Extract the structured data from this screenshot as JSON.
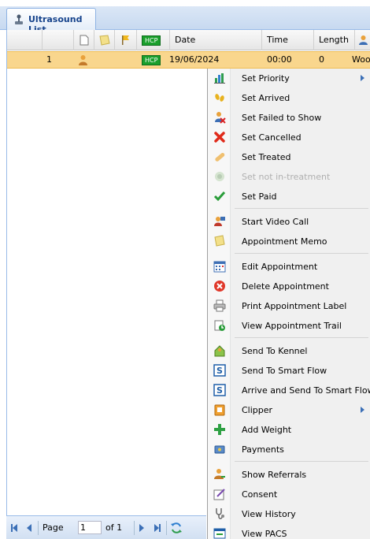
{
  "tab": {
    "label": "Ultrasound List"
  },
  "grid": {
    "headers": {
      "hcp_badge": "HCP",
      "date": "Date",
      "time": "Time",
      "length": "Length"
    },
    "row": {
      "number": "1",
      "hcp_badge": "HCP",
      "date": "19/06/2024",
      "time": "00:00",
      "length": "0",
      "name_partial": "Wooc"
    }
  },
  "pager": {
    "page_label": "Page",
    "page_value": "1",
    "of_label": "of 1"
  },
  "menu": {
    "items": [
      {
        "label": "Set Priority",
        "icon": "chart-icon"
      },
      {
        "label": "Set Arrived",
        "icon": "footprints-icon"
      },
      {
        "label": "Set Failed to Show",
        "icon": "person-cross-icon"
      },
      {
        "label": "Set Cancelled",
        "icon": "red-x-icon"
      },
      {
        "label": "Set Treated",
        "icon": "bandage-icon"
      },
      {
        "label": "Set not in-treatment",
        "icon": "stethoscope-icon"
      },
      {
        "label": "Set Paid",
        "icon": "check-icon"
      },
      {
        "label": "Start Video Call",
        "icon": "video-call-icon"
      },
      {
        "label": "Appointment Memo",
        "icon": "memo-icon"
      },
      {
        "label": "Edit Appointment",
        "icon": "calendar-icon"
      },
      {
        "label": "Delete Appointment",
        "icon": "delete-icon"
      },
      {
        "label": "Print Appointment Label",
        "icon": "printer-icon"
      },
      {
        "label": "View Appointment Trail",
        "icon": "trail-icon"
      },
      {
        "label": "Send To Kennel",
        "icon": "kennel-icon"
      },
      {
        "label": "Send To Smart Flow",
        "icon": "smart-flow-icon"
      },
      {
        "label": "Arrive and Send To Smart Flow",
        "icon": "smart-flow-icon"
      },
      {
        "label": "Clipper",
        "icon": "clipper-icon"
      },
      {
        "label": "Add Weight",
        "icon": "plus-icon"
      },
      {
        "label": "Payments",
        "icon": "payments-icon"
      },
      {
        "label": "Show Referrals",
        "icon": "referrals-icon"
      },
      {
        "label": "Consent",
        "icon": "consent-icon"
      },
      {
        "label": "View History",
        "icon": "history-icon"
      },
      {
        "label": "View PACS",
        "icon": "pacs-icon"
      }
    ]
  },
  "colors": {
    "selected_row": "#f9d68d",
    "hcp_green": "#1a9f2c",
    "tab_text": "#15428b"
  }
}
